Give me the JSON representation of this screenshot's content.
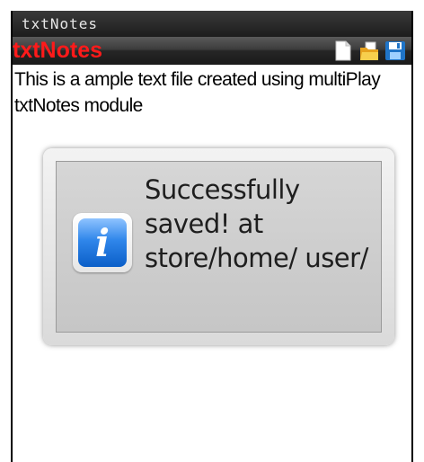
{
  "window": {
    "title": "txtNotes"
  },
  "app": {
    "title": "txtNotes"
  },
  "toolbar": {
    "icons": [
      "new-document-icon",
      "open-folder-icon",
      "save-disk-icon"
    ]
  },
  "editor": {
    "text": "This is a ample text file created using multiPlay txtNotes module"
  },
  "dialog": {
    "icon": "info-icon",
    "message": "Successfully saved! at store/home/ user/"
  },
  "colors": {
    "app_title": "#ff1a1a",
    "accent_blue": "#2f86ea"
  }
}
